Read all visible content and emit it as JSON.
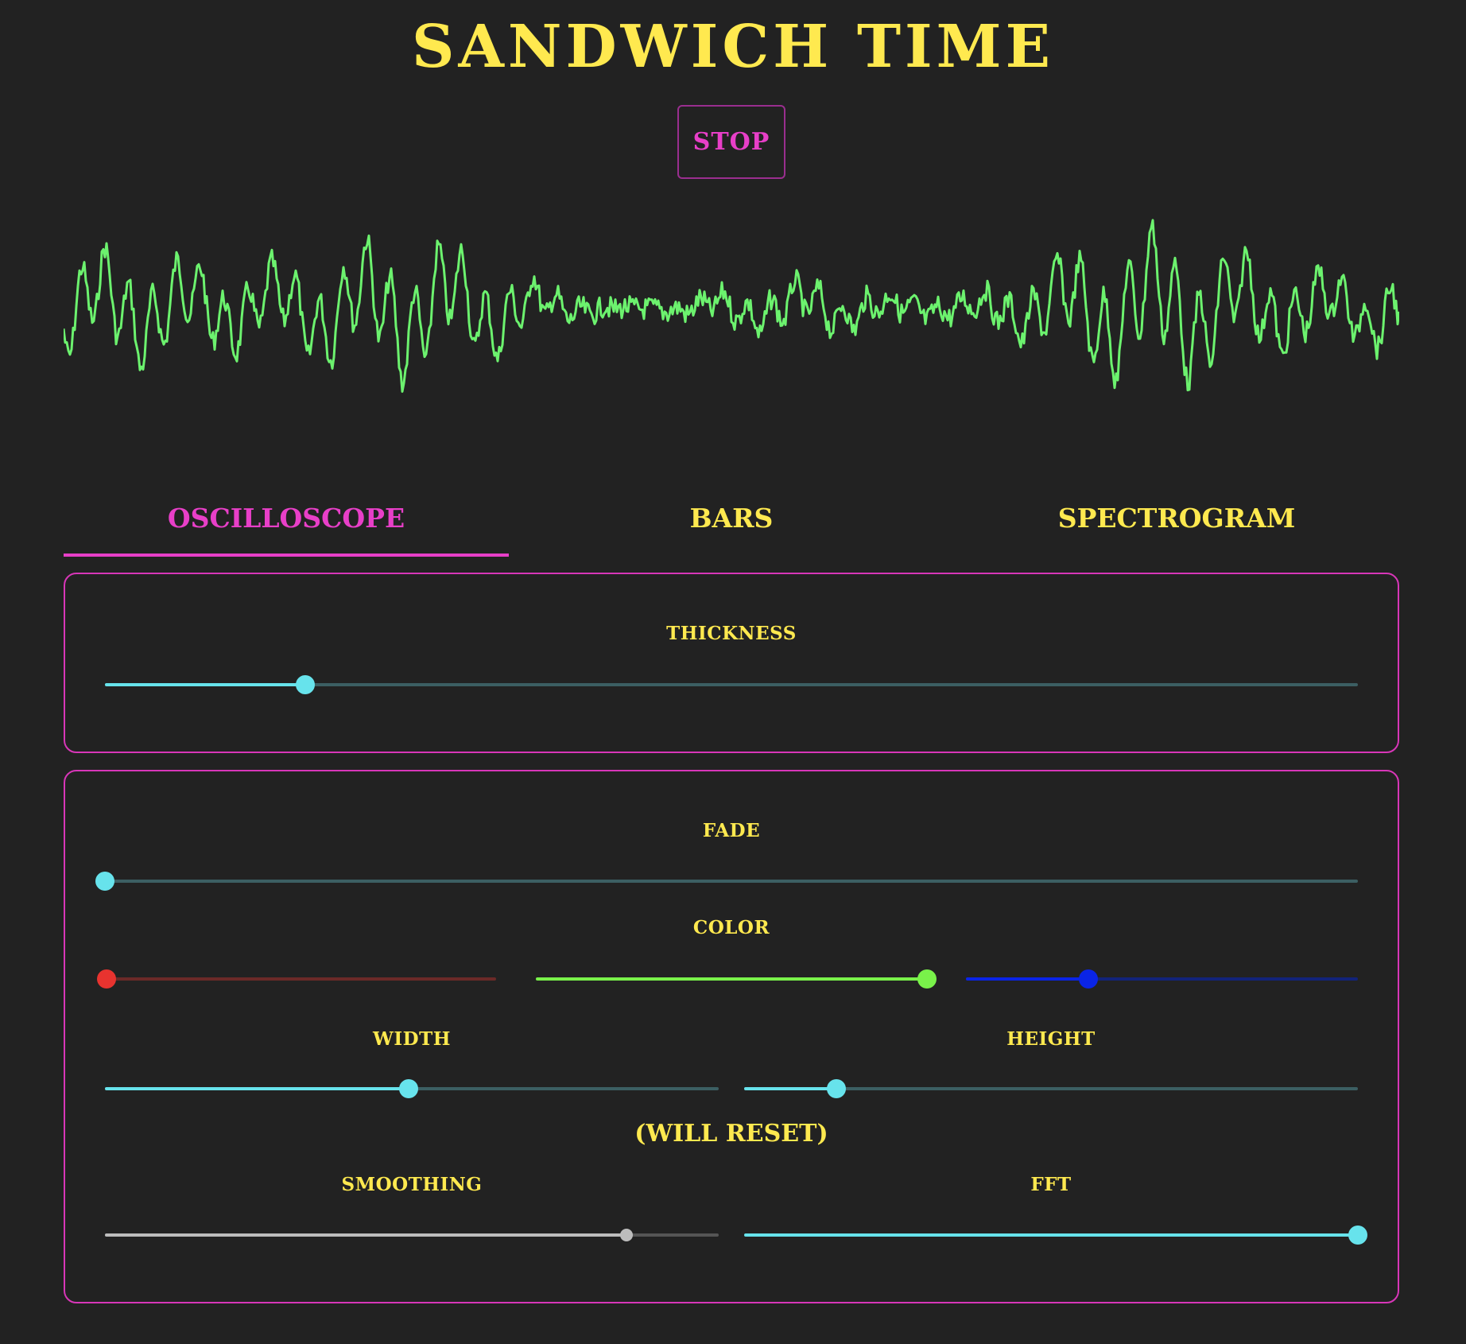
{
  "app": {
    "title": "SANDWICH TIME",
    "stop_label": "STOP"
  },
  "colors": {
    "background": "#222222",
    "title": "#ffe94f",
    "accent": "#e83fc8",
    "wave": "#6cf26e",
    "slider_cyan": "#67e3ec",
    "slider_red": "#e8332f",
    "slider_green": "#79f24a",
    "slider_blue": "#0a24e6",
    "slider_gray": "#bdbdbd"
  },
  "tabs": [
    {
      "label": "OSCILLOSCOPE",
      "active": true
    },
    {
      "label": "BARS",
      "active": false
    },
    {
      "label": "SPECTROGRAM",
      "active": false
    }
  ],
  "controls": {
    "thickness": {
      "label": "THICKNESS",
      "value": 0.16
    },
    "fade": {
      "label": "FADE",
      "value": 0.0
    },
    "color": {
      "label": "COLOR",
      "red": 0.0,
      "green": 1.0,
      "blue": 0.31
    },
    "width": {
      "label": "WIDTH",
      "value": 0.495
    },
    "height": {
      "label": "HEIGHT",
      "value": 0.15
    },
    "reset_note": "(WILL RESET)",
    "smoothing": {
      "label": "SMOOTHING",
      "value": 0.85
    },
    "fft": {
      "label": "FFT",
      "value": 1.0
    }
  },
  "icons": {
    "slider_thumb": "circle"
  }
}
